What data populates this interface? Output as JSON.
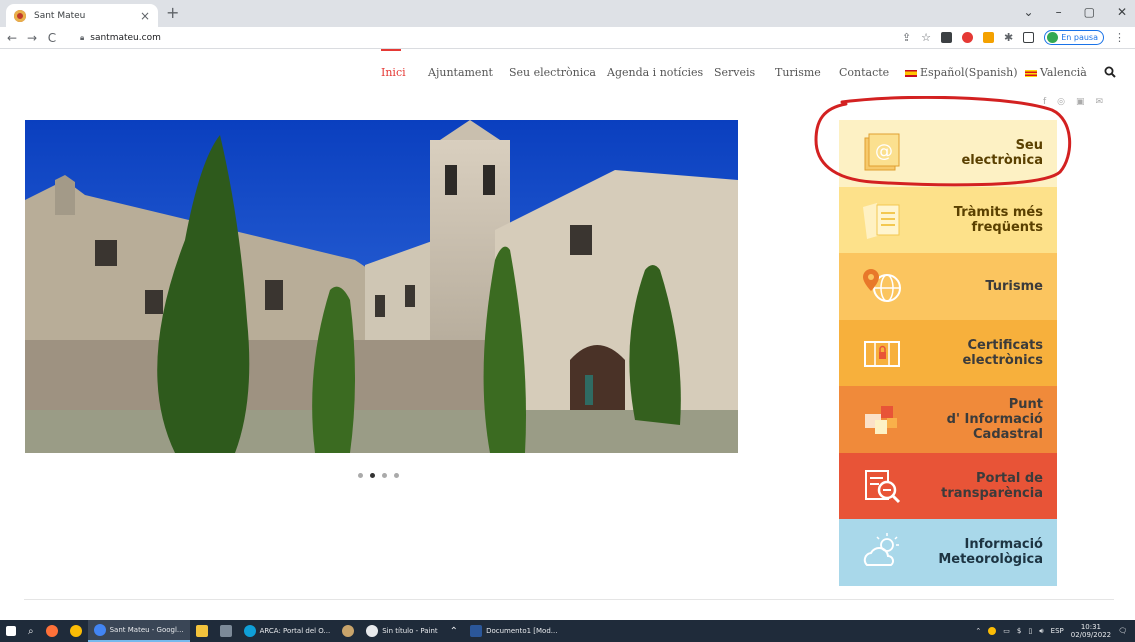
{
  "browser": {
    "tab_title": "Sant Mateu",
    "tab_close": "×",
    "new_tab": "+",
    "url": "santmateu.com",
    "profile_label": "En pausa",
    "window_controls": [
      "⌄",
      "–",
      "▢",
      "✕"
    ],
    "nav": {
      "back": "←",
      "forward": "→",
      "reload": "C"
    }
  },
  "site_nav": {
    "items": [
      "Inici",
      "Ajuntament",
      "Seu electrònica",
      "Agenda i notícies",
      "Serveis",
      "Turisme",
      "Contacte"
    ],
    "lang_es": "Español(Spanish)",
    "lang_va": "Valencià"
  },
  "social_icons": [
    "f",
    "◎",
    "▣",
    "✉"
  ],
  "slider": {
    "slide_count": 4,
    "active_slide": 2
  },
  "tiles": [
    {
      "label": "Seu\nelectrònica",
      "color": "#fdf1c4",
      "icon": "at-sign-icon"
    },
    {
      "label": "Tràmits més\nfreqüents",
      "color": "#fde18a",
      "icon": "documents-icon"
    },
    {
      "label": "Turisme",
      "color": "#fbc55f",
      "icon": "globe-pin-icon"
    },
    {
      "label": "Certificats\nelectrònics",
      "color": "#f7b03c",
      "icon": "certificate-icon"
    },
    {
      "label": "Punt\nd' Informació\nCadastral",
      "color": "#f08a3a",
      "icon": "cadastre-icon"
    },
    {
      "label": "Portal de\ntransparència",
      "color": "#e85437",
      "icon": "magnifier-doc-icon"
    },
    {
      "label": "Informació\nMeteorològica",
      "color": "#a9d8ea",
      "icon": "weather-icon"
    }
  ],
  "taskbar": {
    "apps": [
      "Sant Mateu - Googl...",
      "ARCA: Portal del O...",
      "Sin título - Paint",
      "Documento1 [Mod..."
    ],
    "lang": "ESP",
    "time": "10:31",
    "date": "02/09/2022"
  },
  "colors": {
    "accent": "#e53935",
    "taskbar": "#1f2b3a"
  }
}
